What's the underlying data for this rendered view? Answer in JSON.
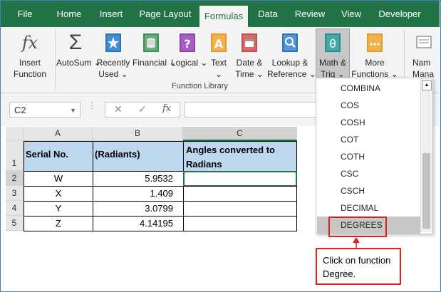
{
  "tabs": [
    "File",
    "Home",
    "Insert",
    "Page Layout",
    "Formulas",
    "Data",
    "Review",
    "View",
    "Developer"
  ],
  "ribbon": {
    "buttons": [
      {
        "l1": "Insert",
        "l2": "Function",
        "icon": "fx-icon"
      },
      {
        "l1": "AutoSum",
        "l2": "",
        "icon": "sigma-icon"
      },
      {
        "l1": "Recently",
        "l2": "Used",
        "icon": "star-book-icon"
      },
      {
        "l1": "Financial",
        "l2": "",
        "icon": "coins-book-icon"
      },
      {
        "l1": "Logical",
        "l2": "",
        "icon": "question-book-icon"
      },
      {
        "l1": "Text",
        "l2": "",
        "icon": "text-book-icon"
      },
      {
        "l1": "Date &",
        "l2": "Time",
        "icon": "calendar-book-icon"
      },
      {
        "l1": "Lookup &",
        "l2": "Reference",
        "icon": "magnifier-book-icon"
      },
      {
        "l1": "Math &",
        "l2": "Trig",
        "icon": "theta-book-icon"
      },
      {
        "l1": "More",
        "l2": "Functions",
        "icon": "dots-book-icon"
      },
      {
        "l1": "Nam",
        "l2": "Mana",
        "icon": "name-manager-icon"
      }
    ],
    "group_label": "Function Library"
  },
  "formula_bar": {
    "name_box": "C2",
    "fx": "fx",
    "value": ""
  },
  "sheet": {
    "columns": [
      "A",
      "B",
      "C"
    ],
    "rows": [
      "1",
      "2",
      "3",
      "4",
      "5"
    ],
    "header": [
      "Serial No.",
      "(Radiants)",
      "Angles converted to Radians"
    ],
    "data": [
      [
        "W",
        "5.9532",
        ""
      ],
      [
        "X",
        "1.409",
        ""
      ],
      [
        "Y",
        "3.0799",
        ""
      ],
      [
        "Z",
        "4.14195",
        ""
      ]
    ]
  },
  "dropdown": [
    "COMBINA",
    "COS",
    "COSH",
    "COT",
    "COTH",
    "CSC",
    "CSCH",
    "DECIMAL",
    "DEGREES"
  ],
  "callout": {
    "line1": "Click on function",
    "line2": "Degree."
  },
  "colors": {
    "excel_green": "#217346",
    "header_fill": "#bdd7ee",
    "annotation_red": "#e02020"
  }
}
